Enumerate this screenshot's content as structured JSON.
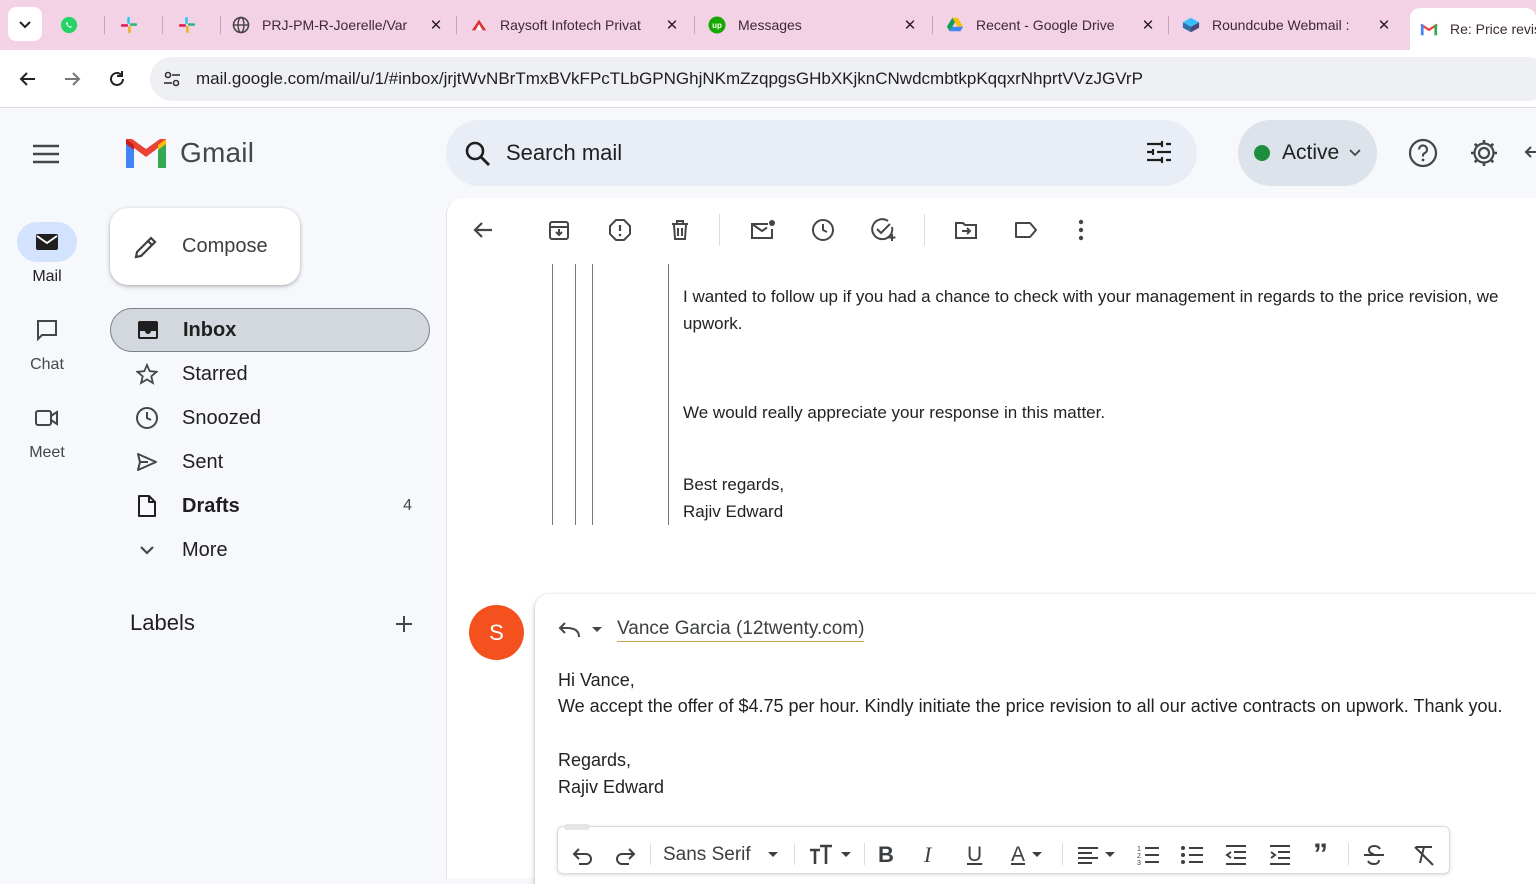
{
  "browser": {
    "tabs": [
      {
        "title": "",
        "icon": "whatsapp-icon"
      },
      {
        "title": "",
        "icon": "slack-icon"
      },
      {
        "title": "",
        "icon": "slack-icon"
      },
      {
        "title": "PRJ-PM-R-Joerelle/Var",
        "icon": "globe-icon"
      },
      {
        "title": "Raysoft Infotech Privat",
        "icon": "raysoft-icon"
      },
      {
        "title": "Messages",
        "icon": "upwork-icon"
      },
      {
        "title": "Recent - Google Drive",
        "icon": "google-drive-icon"
      },
      {
        "title": "Roundcube Webmail :",
        "icon": "roundcube-icon"
      },
      {
        "title": "Re: Price revis",
        "icon": "gmail-icon"
      }
    ],
    "url": "mail.google.com/mail/u/1/#inbox/jrjtWvNBrTmxBVkFPcTLbGPNGhjNKmZzqpgsGHbXKjknCNwdcmbtkpKqqxrNhprtVVzJGVrP"
  },
  "rail": {
    "items": [
      {
        "label": "Mail",
        "icon": "mail-icon"
      },
      {
        "label": "Chat",
        "icon": "chat-icon"
      },
      {
        "label": "Meet",
        "icon": "meet-icon"
      }
    ]
  },
  "app": {
    "name": "Gmail"
  },
  "sidebar": {
    "compose": "Compose",
    "items": [
      {
        "label": "Inbox",
        "icon": "inbox-icon",
        "count": ""
      },
      {
        "label": "Starred",
        "icon": "star-icon",
        "count": ""
      },
      {
        "label": "Snoozed",
        "icon": "clock-icon",
        "count": ""
      },
      {
        "label": "Sent",
        "icon": "send-icon",
        "count": ""
      },
      {
        "label": "Drafts",
        "icon": "draft-icon",
        "count": "4"
      },
      {
        "label": "More",
        "icon": "chevron-down-icon",
        "count": ""
      }
    ],
    "labels_heading": "Labels"
  },
  "header": {
    "search_placeholder": "Search mail",
    "status": "Active",
    "status_color": "#1e8e3e"
  },
  "message": {
    "quoted": {
      "p1_line1": "I wanted to follow up if you had a chance to check with your management in regards to the price revision, we",
      "p1_line2": "upwork.",
      "p2": "We would really appreciate your response in this matter.",
      "closing": "Best regards,",
      "signature": "Rajiv Edward"
    }
  },
  "reply": {
    "avatar_letter": "S",
    "avatar_color": "#f4511e",
    "recipient": "Vance Garcia (12twenty.com)",
    "greeting": "Hi Vance,",
    "body": "We accept the offer of $4.75 per hour. Kindly initiate the price revision to all our active contracts on upwork. Thank you.",
    "closing": "Regards,",
    "signature": "Rajiv Edward",
    "font": "Sans Serif"
  }
}
